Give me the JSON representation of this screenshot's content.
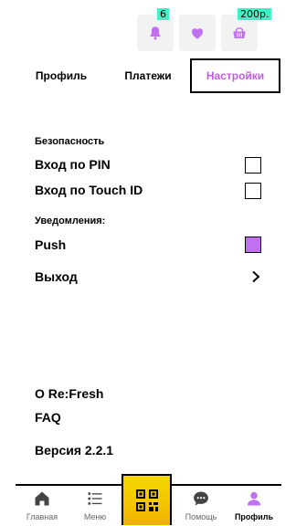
{
  "header": {
    "notifications_badge": "6",
    "balance_badge": "200р.",
    "icons": [
      "bell-icon",
      "heart-icon",
      "basket-icon"
    ]
  },
  "tabs": [
    {
      "label": "Профиль",
      "active": false
    },
    {
      "label": "Платежи",
      "active": false
    },
    {
      "label": "Настройки",
      "active": true
    }
  ],
  "security": {
    "title": "Безопасность",
    "pin_label": "Вход по PIN",
    "pin_checked": false,
    "touchid_label": "Вход по Touch ID",
    "touchid_checked": false
  },
  "notifications": {
    "title": "Уведомления:",
    "push_label": "Push",
    "push_checked": true
  },
  "logout_label": "Выход",
  "links": {
    "about": "О Re:Fresh",
    "faq": "FAQ",
    "version": "Версия 2.2.1"
  },
  "bottom_nav": [
    {
      "label": "Главная",
      "icon": "home-icon"
    },
    {
      "label": "Меню",
      "icon": "menu-list-icon"
    },
    {
      "label": "",
      "icon": "qr-code-icon"
    },
    {
      "label": "Помощь",
      "icon": "chat-icon"
    },
    {
      "label": "Профиль",
      "icon": "user-icon",
      "active": true
    }
  ],
  "colors": {
    "accent": "#c35be8",
    "checkbox_checked": "#c070f0",
    "badge": "#3ff2c5",
    "qr_button": "#f2c400"
  }
}
